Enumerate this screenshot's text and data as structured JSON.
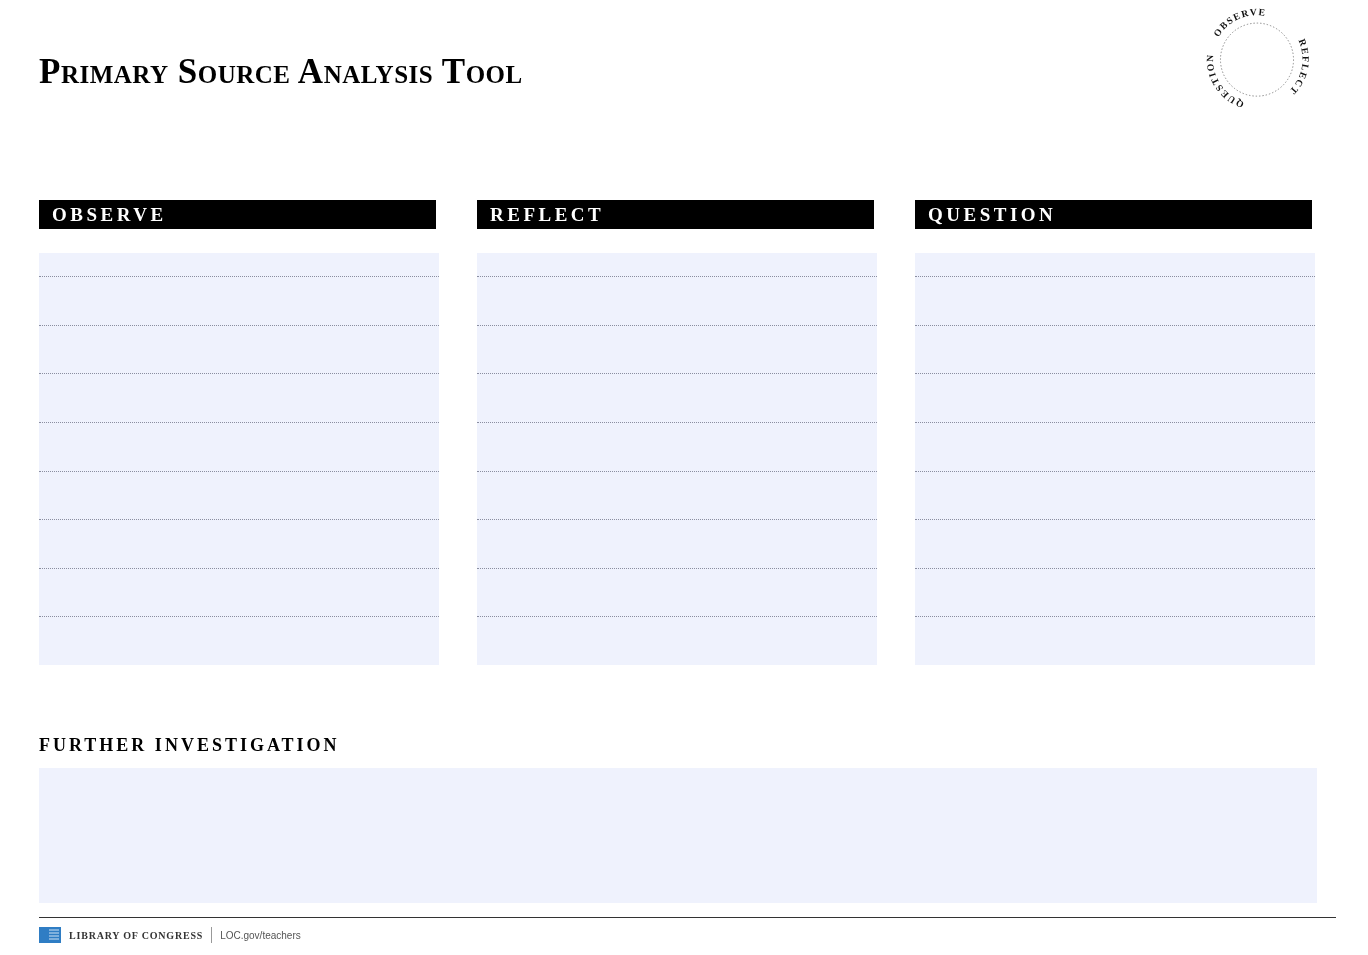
{
  "title": "Primary Source Analysis Tool",
  "cycle_logo": {
    "words": [
      "OBSERVE",
      "REFLECT",
      "QUESTION"
    ]
  },
  "columns": [
    {
      "heading": "OBSERVE"
    },
    {
      "heading": "REFLECT"
    },
    {
      "heading": "QUESTION"
    }
  ],
  "further": {
    "heading": "FURTHER INVESTIGATION"
  },
  "footer": {
    "org": "LIBRARY OF CONGRESS",
    "link": "LOC.gov/teachers"
  }
}
